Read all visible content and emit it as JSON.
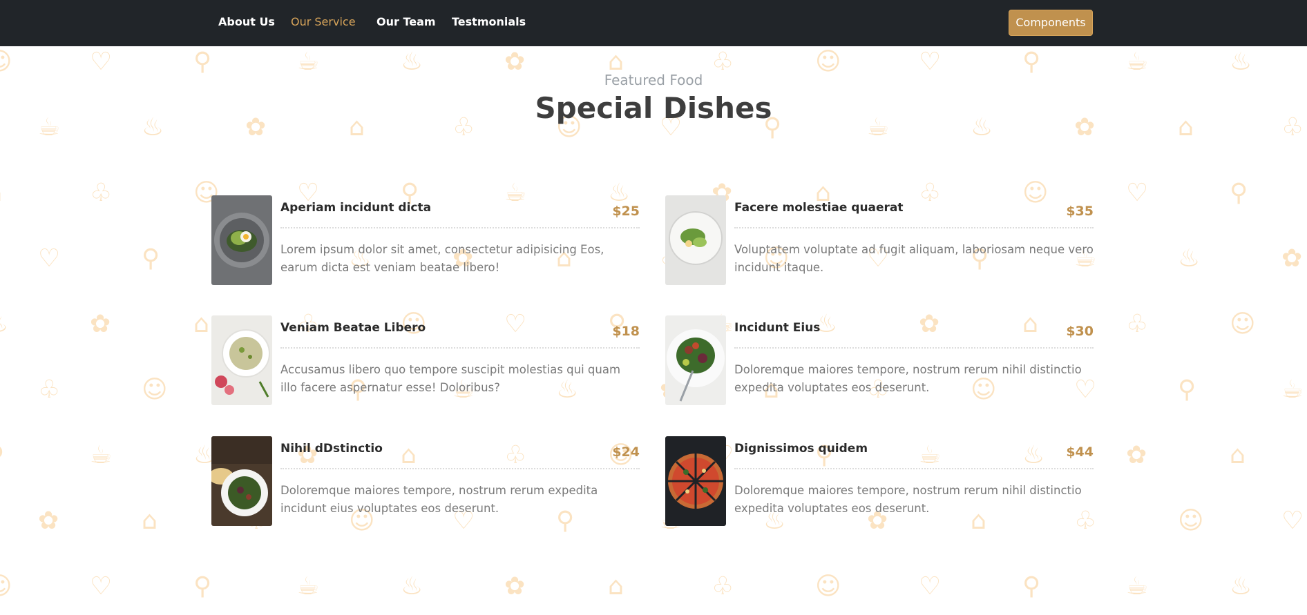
{
  "nav": {
    "items": [
      {
        "label": "About Us",
        "active": false
      },
      {
        "label": "Our Service",
        "active": true
      },
      {
        "label": "Our Team",
        "active": false
      },
      {
        "label": "Testmonials",
        "active": false
      }
    ],
    "button_label": "Components"
  },
  "header": {
    "subtitle": "Featured Food",
    "title": "Special Dishes"
  },
  "dishes": [
    {
      "name": "Aperiam incidunt dicta",
      "price": "$25",
      "description": "Lorem ipsum dolor sit amet, consectetur adipisicing Eos, earum dicta est veniam beatae libero!",
      "image": "avocado-toast-on-plate"
    },
    {
      "name": "Facere molestiae quaerat",
      "price": "$35",
      "description": "Voluptatem voluptate ad fugit aliquam, laboriosam neque vero incidunt itaque.",
      "image": "salad-plate-white"
    },
    {
      "name": "Veniam Beatae Libero",
      "price": "$18",
      "description": "Accusamus libero quo tempore suscipit molestias qui quam illo facere aspernatur esse! Doloribus?",
      "image": "grain-bowl-with-radish"
    },
    {
      "name": "Incidunt Eius",
      "price": "$30",
      "description": "Doloremque maiores tempore, nostrum rerum nihil distinctio expedita voluptates eos deserunt.",
      "image": "vegetable-salad-with-fork"
    },
    {
      "name": "Nihil dDstinctio",
      "price": "$24",
      "description": "Doloremque maiores tempore, nostrum rerum expedita incidunt eius voluptates eos deserunt.",
      "image": "salad-on-wooden-table"
    },
    {
      "name": "Dignissimos quidem",
      "price": "$44",
      "description": "Doloremque maiores tempore, nostrum rerum nihil distinctio expedita voluptates eos deserunt.",
      "image": "sliced-pizza"
    }
  ],
  "colors": {
    "navbar_bg": "#212529",
    "accent": "#c0914e",
    "active_nav": "#d7a45a",
    "pattern": "#fbe3c2"
  }
}
